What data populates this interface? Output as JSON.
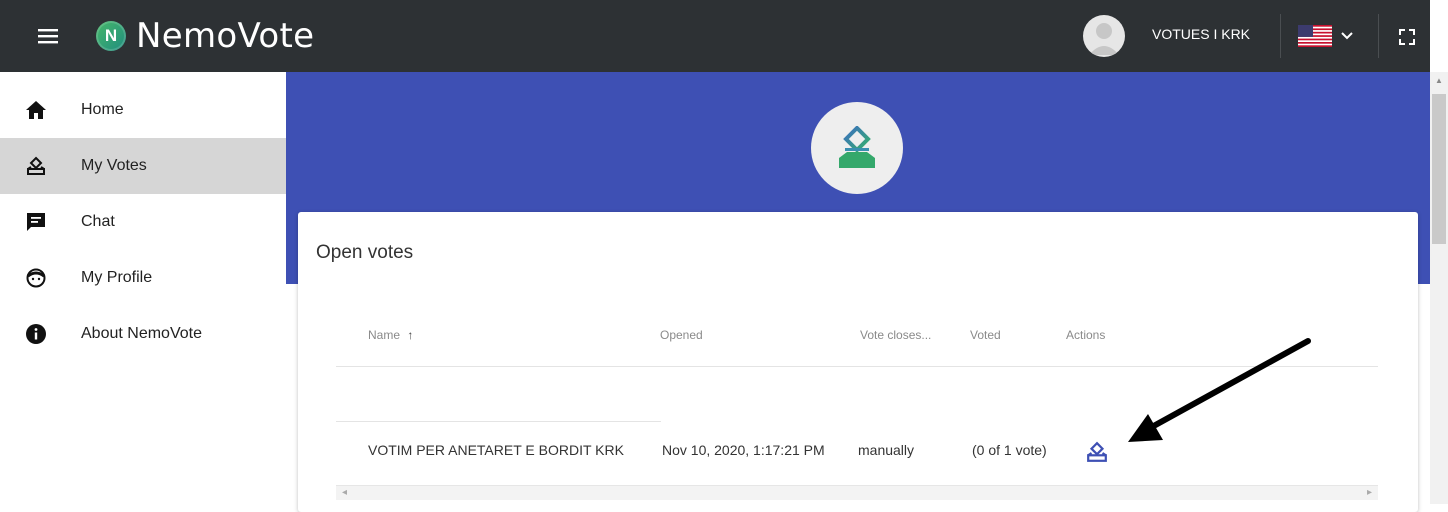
{
  "app": {
    "logo_letter": "N",
    "logo_text": "NemoVote"
  },
  "header": {
    "user_name": "VOTUES I KRK",
    "icons": [
      "menu-icon",
      "avatar",
      "us-flag-icon",
      "chevron-down-icon",
      "fullscreen-icon"
    ]
  },
  "sidebar": {
    "items": [
      {
        "label": "Home",
        "icon": "home-icon",
        "active": false
      },
      {
        "label": "My Votes",
        "icon": "ballot-icon",
        "active": true
      },
      {
        "label": "Chat",
        "icon": "chat-icon",
        "active": false
      },
      {
        "label": "My Profile",
        "icon": "face-icon",
        "active": false
      },
      {
        "label": "About NemoVote",
        "icon": "info-icon",
        "active": false
      }
    ]
  },
  "main": {
    "title": "Open votes",
    "columns": [
      "Name",
      "Opened",
      "Vote closes...",
      "Voted",
      "Actions"
    ],
    "sort_indicator": "↑",
    "rows": [
      {
        "name": "VOTIM PER ANETARET E BORDIT KRK",
        "opened": "Nov 10, 2020, 1:17:21 PM",
        "closes": "manually",
        "voted": "(0 of 1 vote)",
        "action_icon": "ballot-icon"
      }
    ]
  },
  "colors": {
    "topbar": "#2d3134",
    "banner": "#3e50b4",
    "active_nav": "#d6d6d6",
    "accent": "#3e50b4",
    "logo_green": "#3aa86a"
  }
}
